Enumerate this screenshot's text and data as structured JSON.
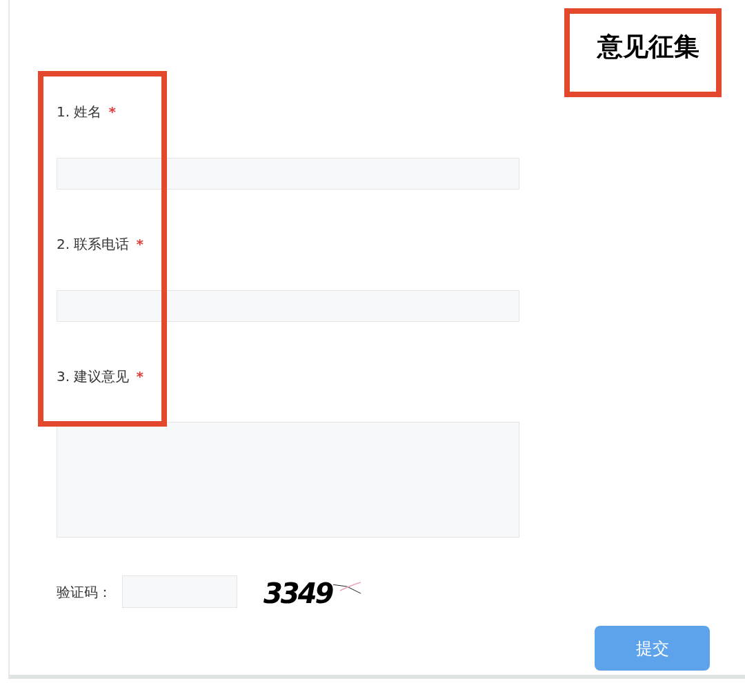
{
  "title": {
    "text": "意见征集",
    "highlighted": true
  },
  "labels_highlighted": true,
  "fields": [
    {
      "number": "1.",
      "label": "姓名",
      "required_mark": "*",
      "kind": "input"
    },
    {
      "number": "2.",
      "label": "联系电话",
      "required_mark": "*",
      "kind": "input"
    },
    {
      "number": "3.",
      "label": "建议意见",
      "required_mark": "*",
      "kind": "textarea"
    }
  ],
  "captcha": {
    "label": "验证码：",
    "code": "3349"
  },
  "submit": "提交"
}
